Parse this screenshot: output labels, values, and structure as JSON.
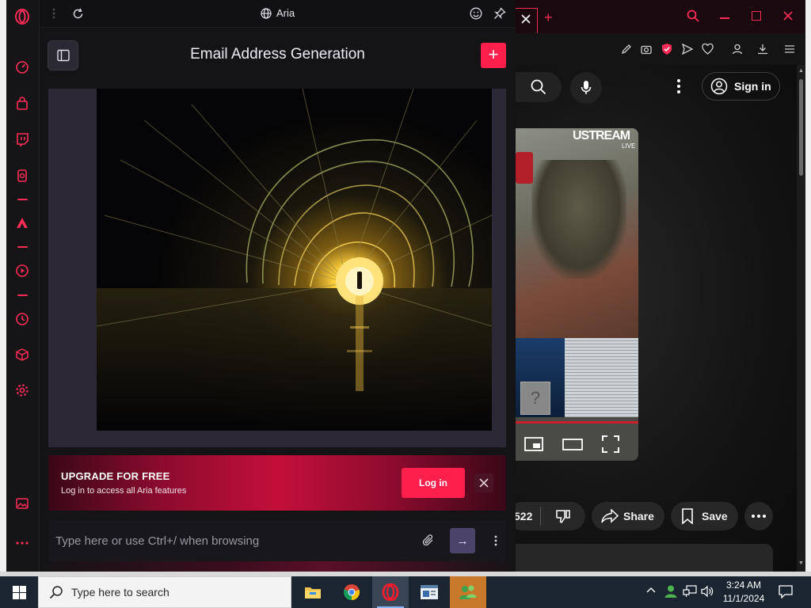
{
  "aria": {
    "window_title": "Aria",
    "chat_title": "Email Address Generation",
    "new_chat_label": "+",
    "upgrade": {
      "title": "UPGRADE FOR FREE",
      "subtitle": "Log in to access all Aria features",
      "login_label": "Log in"
    },
    "input": {
      "placeholder": "Type here or use Ctrl+/ when browsing",
      "send_label": "→"
    }
  },
  "browser": {
    "new_tab_label": "+",
    "youtube": {
      "sign_in_label": "Sign in",
      "like_count": "522",
      "share_label": "Share",
      "save_label": "Save",
      "video_watermark": "USTREAM",
      "video_watermark_sub": "LIVE"
    }
  },
  "taskbar": {
    "search_placeholder": "Type here to search",
    "time": "3:24 AM",
    "date": "11/1/2024"
  },
  "colors": {
    "accent": "#ff1f4c",
    "aria_bg": "#141316",
    "send_button": "#4b4369",
    "taskbar": "#1b2532"
  }
}
